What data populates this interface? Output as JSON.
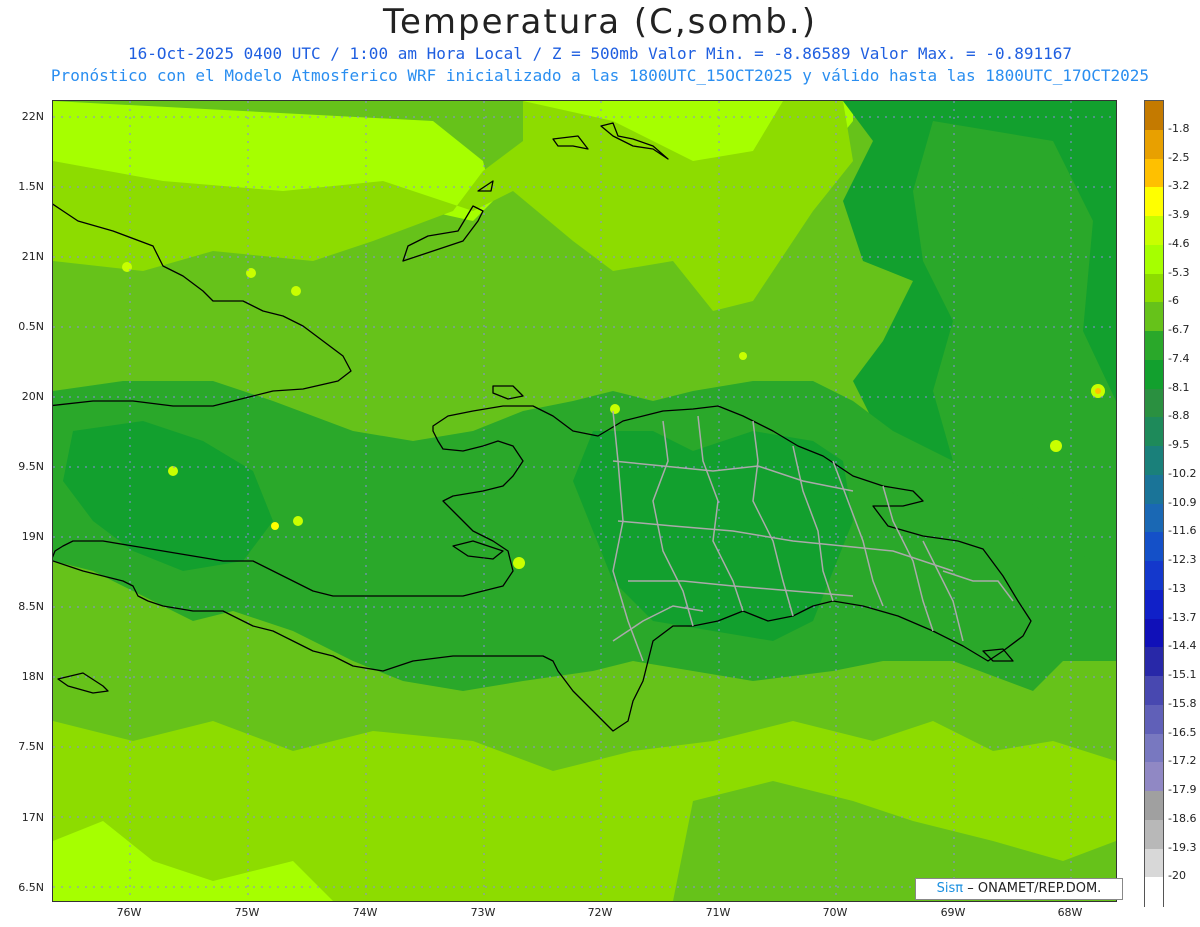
{
  "title": "Temperatura (C,somb.)",
  "subtitle_line1": "16-Oct-2025  0400 UTC / 1:00 am Hora Local / Z = 500mb  Valor Min. = -8.86589  Valor Max. = -0.891167",
  "subtitle_line2": "Pronóstico con el Modelo Atmosferico WRF inicializado a las 1800UTC_15OCT2025 y válido hasta las  1800UTC_17OCT2025",
  "map": {
    "lat_labels": [
      "22N",
      "1.5N",
      "21N",
      "0.5N",
      "20N",
      "9.5N",
      "19N",
      "8.5N",
      "18N",
      "7.5N",
      "17N",
      "6.5N"
    ],
    "lon_labels": [
      "76W",
      "75W",
      "74W",
      "73W",
      "72W",
      "71W",
      "70W",
      "69W",
      "68W"
    ],
    "base_fill_color": "#66c21a",
    "region_colors": {
      "light": "#a6ff00",
      "mid_light": "#8ddc00",
      "mid": "#66c21a",
      "dark": "#2aa82a",
      "darker": "#12a02e"
    },
    "coastline_color": "#000000",
    "province_boundary_color": "#aaaaaa",
    "gridline_color": "#8a8ae0"
  },
  "colorbar": {
    "labels": [
      "-1.8",
      "-2.5",
      "-3.2",
      "-3.9",
      "-4.6",
      "-5.3",
      "-6",
      "-6.7",
      "-7.4",
      "-8.1",
      "-8.8",
      "-9.5",
      "-10.2",
      "-10.9",
      "-11.6",
      "-12.3",
      "-13",
      "-13.7",
      "-14.4",
      "-15.1",
      "-15.8",
      "-16.5",
      "-17.2",
      "-17.9",
      "-18.6",
      "-19.3",
      "-20"
    ],
    "colors": [
      "#c47a00",
      "#e8a000",
      "#ffc000",
      "#ffff00",
      "#c8ff00",
      "#a6ff00",
      "#8ddc00",
      "#66c21a",
      "#2aa82a",
      "#12a02e",
      "#2a9040",
      "#1e8a5a",
      "#1a807a",
      "#1a7498",
      "#1a68b4",
      "#1450c8",
      "#1438cc",
      "#1020c8",
      "#1010b8",
      "#2828a8",
      "#4848b0",
      "#6060b8",
      "#7878c0",
      "#9088c4",
      "#a0a0a0",
      "#b8b8b8",
      "#d8d8d8",
      "#ffffff"
    ]
  },
  "credit": {
    "brand": "Sisπ",
    "text": "– ONAMET/REP.DOM."
  }
}
